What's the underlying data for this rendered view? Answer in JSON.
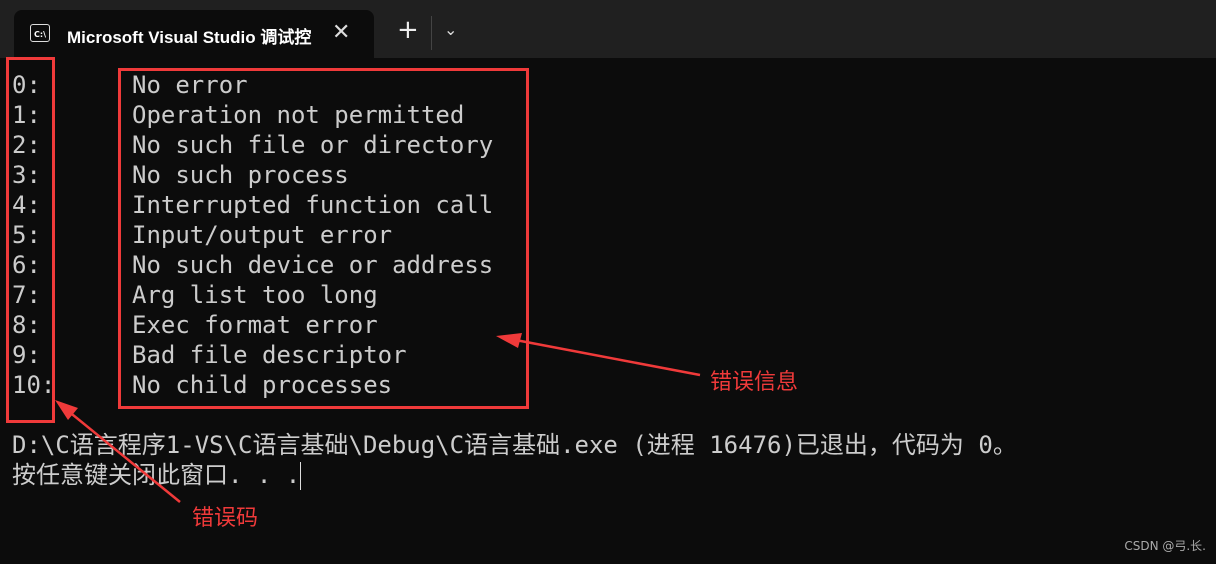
{
  "window": {
    "tab_title": "Microsoft Visual Studio 调试控",
    "tab_icon": "console-icon",
    "close": "✕",
    "new_tab": "+",
    "dropdown": "⌄"
  },
  "errors": [
    {
      "code": "0:",
      "message": "No error"
    },
    {
      "code": "1:",
      "message": "Operation not permitted"
    },
    {
      "code": "2:",
      "message": "No such file or directory"
    },
    {
      "code": "3:",
      "message": "No such process"
    },
    {
      "code": "4:",
      "message": "Interrupted function call"
    },
    {
      "code": "5:",
      "message": "Input/output error"
    },
    {
      "code": "6:",
      "message": "No such device or address"
    },
    {
      "code": "7:",
      "message": "Arg list too long"
    },
    {
      "code": "8:",
      "message": "Exec format error"
    },
    {
      "code": "9:",
      "message": "Bad file descriptor"
    },
    {
      "code": "10:",
      "message": "No child processes"
    }
  ],
  "exit_line": "D:\\C语言程序1-VS\\C语言基础\\Debug\\C语言基础.exe (进程 16476)已退出，代码为 0。",
  "prompt_line": "按任意键关闭此窗口. . .",
  "annotations": {
    "message_label": "错误信息",
    "code_label": "错误码",
    "color": "#f03a3a"
  },
  "watermark": "CSDN @弓.长."
}
